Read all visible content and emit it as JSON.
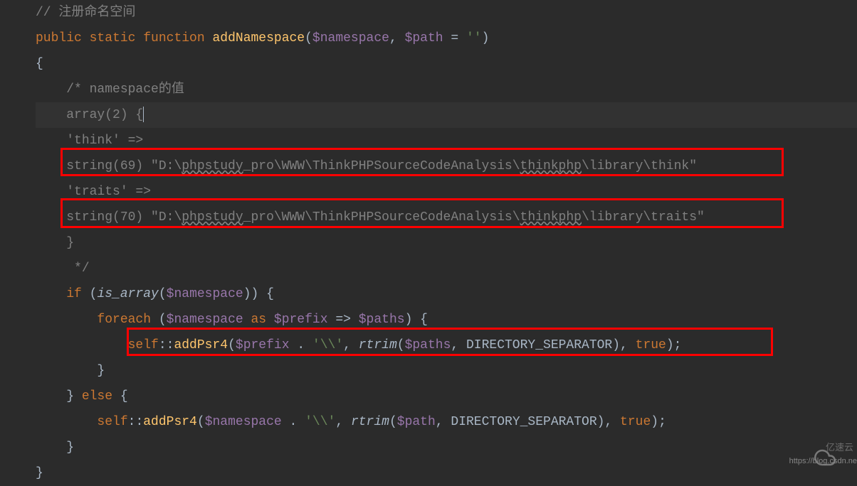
{
  "code": {
    "line1_comment": "// 注册命名空间",
    "line2_public": "public",
    "line2_static": "static",
    "line2_function": "function",
    "line2_name": "addNamespace",
    "line2_paren_open": "(",
    "line2_var1": "$namespace",
    "line2_comma": ", ",
    "line2_var2": "$path",
    "line2_eq": " = ",
    "line2_str": "''",
    "line2_paren_close": ")",
    "line3_brace": "{",
    "line4_comment": "/* namespace的值",
    "line5_comment": "array(2) {",
    "line6_comment": "'think' =>",
    "line7_p1": "string(69) \"D:\\",
    "line7_p2": "phpstudy",
    "line7_p3": "_pro\\WWW\\ThinkPHPSourceCodeAnalysis\\",
    "line7_p4": "thinkphp",
    "line7_p5": "\\library\\think\"",
    "line8_comment": "'traits' =>",
    "line9_p1": "string(70) \"D:\\",
    "line9_p2": "phpstudy",
    "line9_p3": "_pro\\WWW\\ThinkPHPSourceCodeAnalysis\\",
    "line9_p4": "thinkphp",
    "line9_p5": "\\library\\traits\"",
    "line10_comment": "}",
    "line11_comment": " */",
    "line12_if": "if",
    "line12_paren_open": " (",
    "line12_func": "is_array",
    "line12_open2": "(",
    "line12_var": "$namespace",
    "line12_close": ")) {",
    "line13_foreach": "foreach",
    "line13_paren": " (",
    "line13_var1": "$namespace",
    "line13_as": " as ",
    "line13_var2": "$prefix",
    "line13_arrow": " => ",
    "line13_var3": "$paths",
    "line13_close": ") {",
    "line14_self": "self",
    "line14_dcolon": "::",
    "line14_method": "addPsr4",
    "line14_open": "(",
    "line14_var1": "$prefix",
    "line14_dot": " . ",
    "line14_str": "'\\\\'",
    "line14_comma": ", ",
    "line14_rtrim": "rtrim",
    "line14_open2": "(",
    "line14_var2": "$paths",
    "line14_comma2": ", ",
    "line14_const": "DIRECTORY_SEPARATOR",
    "line14_close": "), ",
    "line14_true": "true",
    "line14_end": ");",
    "line15_brace": "}",
    "line16_brace": "}",
    "line16_else": " else ",
    "line16_brace2": "{",
    "line17_self": "self",
    "line17_dcolon": "::",
    "line17_method": "addPsr4",
    "line17_open": "(",
    "line17_var1": "$namespace",
    "line17_dot": " . ",
    "line17_str": "'\\\\'",
    "line17_comma": ", ",
    "line17_rtrim": "rtrim",
    "line17_open2": "(",
    "line17_var2": "$path",
    "line17_comma2": ", ",
    "line17_const": "DIRECTORY_SEPARATOR",
    "line17_close": "), ",
    "line17_true": "true",
    "line17_end": ");",
    "line18_brace": "}",
    "line19_brace": "}"
  },
  "watermark": {
    "url": "https://blog.csdn.ne",
    "brand": "亿速云"
  }
}
